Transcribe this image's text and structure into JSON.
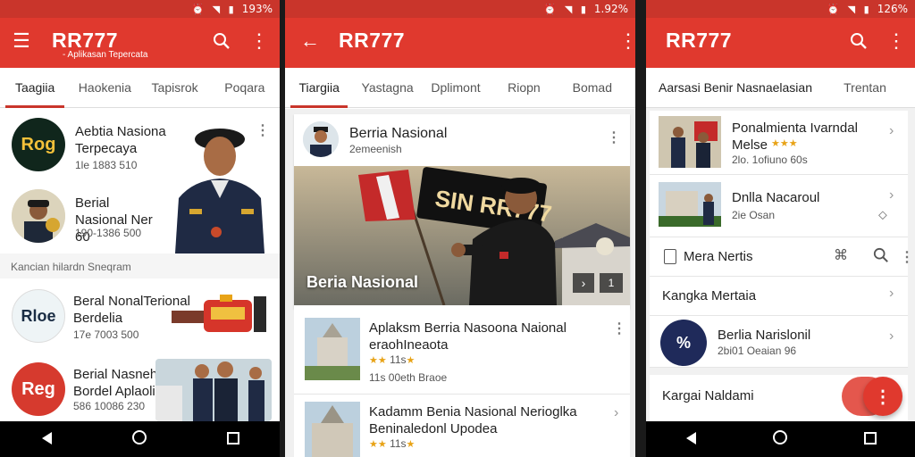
{
  "status": {
    "left_battery": "193%",
    "middle_battery": "1.92%",
    "right_battery": "126%"
  },
  "panel1": {
    "app_title": "RR777",
    "app_subtitle": "- Aplikasan Tepercata",
    "tabs": [
      "Taagiia",
      "Haokenia",
      "Tapisrok",
      "Poqara"
    ],
    "items": [
      {
        "logo_text": "Rog",
        "title": "Aebtia Nasional Terpecaya",
        "meta": "1le  1883 510"
      },
      {
        "title": "Berial Nasional Ner 60",
        "meta": "190-1386 500"
      }
    ],
    "section": "Kancian hilardn Sneqram",
    "items2": [
      {
        "logo_text": "Rloe",
        "title": "Beral NonalTerional Berdelia",
        "meta": "17e  7003 500"
      },
      {
        "logo_text": "Reg",
        "title": "Berial Nasneht Bordel Aplaolic",
        "meta": "586 10086 230"
      }
    ]
  },
  "panel2": {
    "app_title": "RR777",
    "tabs": [
      "Tiargiia",
      "Yastagna",
      "Dplimont",
      "Riopn",
      "Bomad"
    ],
    "card": {
      "title": "Berria Nasional",
      "sub": "2emeenish"
    },
    "hero": {
      "banner": "SIN RR777",
      "caption": "Beria Nasional"
    },
    "list": [
      {
        "title": "Aplaksm Berria Nasoona Naional eraohIneaota",
        "rating": "11s",
        "stars": "★★",
        "meta": "11s 00eth Braoe"
      },
      {
        "title": "Kadamm Benia Nasional Nerioglka Beninaledonl Upodea",
        "rating": "11s",
        "stars": "★★",
        "meta": ""
      }
    ]
  },
  "panel3": {
    "app_title": "RR777",
    "tab_main": "Aarsasi Benir Nasnaelasian",
    "tab_other": "Trentan",
    "rows": [
      {
        "title": "Ponalmienta Ivarndal Melse",
        "stars": "★★★",
        "meta": "2lo. 1ofiuno 60s"
      },
      {
        "title": "Dnlla Nacaroul",
        "meta": "2ie Osan"
      }
    ],
    "menu": [
      {
        "label": "Mera Nertis"
      },
      {
        "label": "Kangka Mertaia"
      },
      {
        "label": "Berlia Narislonil",
        "meta": "2bi01 Oeaian 96"
      }
    ],
    "bottom_label": "Kargai Naldami"
  },
  "icons": {
    "accent": "#e0392e",
    "dark_accent": "#c9352b"
  }
}
